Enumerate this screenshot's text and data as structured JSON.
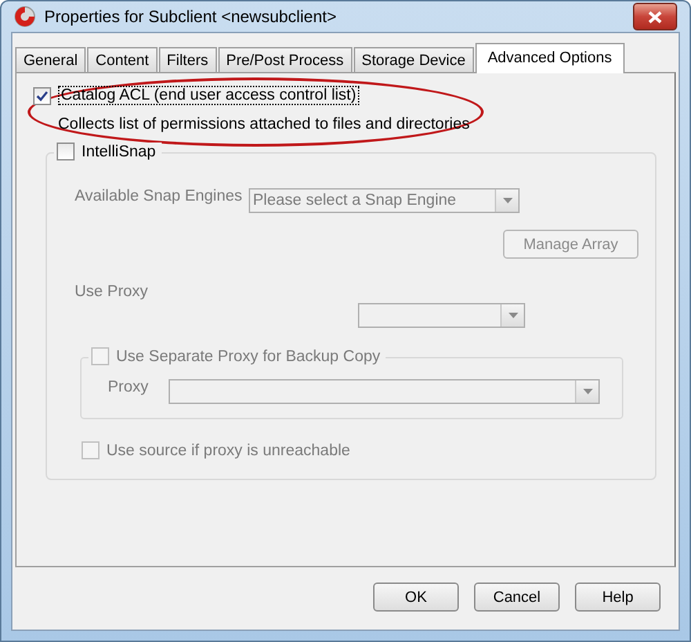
{
  "window": {
    "title": "Properties for Subclient <newsubclient>"
  },
  "tabs": [
    {
      "label": "General",
      "selected": false
    },
    {
      "label": "Content",
      "selected": false
    },
    {
      "label": "Filters",
      "selected": false
    },
    {
      "label": "Pre/Post Process",
      "selected": false
    },
    {
      "label": "Storage Device",
      "selected": false
    },
    {
      "label": "Advanced Options",
      "selected": true
    }
  ],
  "catalog_acl": {
    "label": "Catalog ACL (end user access control list)",
    "checked": true,
    "description": "Collects list of permissions attached to files and directories"
  },
  "intellisnap": {
    "label": "IntelliSnap",
    "checked": false,
    "fields": [
      {
        "kind": "select",
        "label": "Available Snap Engines",
        "value": "Please select a Snap Engine",
        "disabled": true
      },
      {
        "kind": "button",
        "label": "Manage Array",
        "disabled": true
      },
      {
        "kind": "select",
        "label": "Use Proxy",
        "disabled": true
      },
      {
        "kind": "group",
        "label": "Use Separate Proxy for Backup Copy",
        "checked": false,
        "disabled": true,
        "fields": [
          {
            "kind": "select",
            "label": "Proxy",
            "disabled": true
          }
        ]
      },
      {
        "kind": "checkbox",
        "label": "Use source if proxy is unreachable",
        "checked": false,
        "disabled": true
      }
    ]
  },
  "buttons": [
    "OK",
    "Cancel",
    "Help"
  ]
}
